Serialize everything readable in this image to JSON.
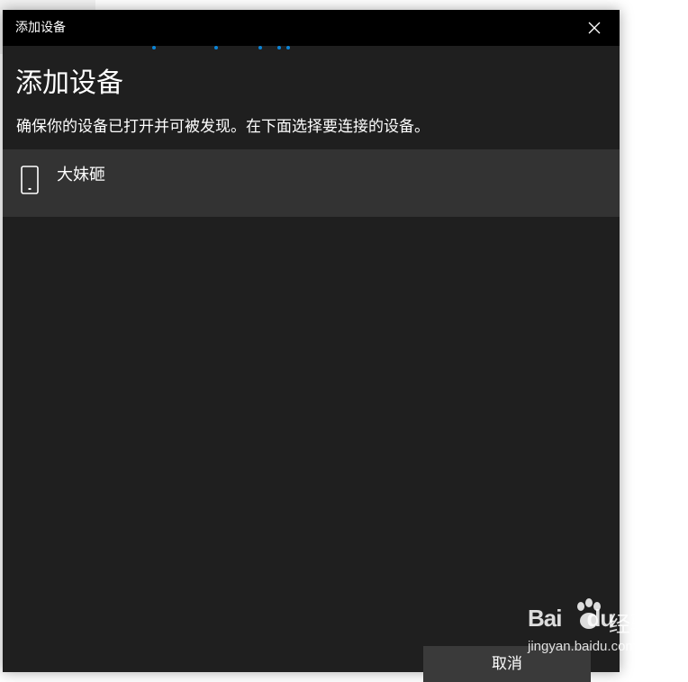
{
  "window": {
    "title": "添加设备",
    "close_icon": "close-icon"
  },
  "main": {
    "heading": "添加设备",
    "instruction": "确保你的设备已打开并可被发现。在下面选择要连接的设备。",
    "devices": [
      {
        "name": "大妹砸",
        "icon": "phone-icon"
      }
    ]
  },
  "footer": {
    "cancel_label": "取消"
  },
  "watermark": {
    "logo_text": "Bai",
    "logo_suffix": "du",
    "brand_text": "经验",
    "url": "jingyan.baidu.com"
  },
  "colors": {
    "titlebar": "#000000",
    "dialog_bg": "#1f1f1f",
    "selected_item_bg": "#333333",
    "accent": "#0a84d6",
    "text": "#ffffff"
  }
}
